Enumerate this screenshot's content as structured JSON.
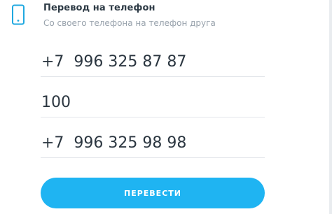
{
  "header": {
    "icon": "phone-icon",
    "title": "Перевод на телефон",
    "subtitle": "Со своего телефона на телефон друга"
  },
  "form": {
    "sender_phone": "+7  996 325 87 87",
    "amount": "100",
    "recipient_phone": "+7  996 325 98 98"
  },
  "actions": {
    "submit_label": "ПЕРЕВЕСТИ"
  },
  "colors": {
    "accent": "#1fb4f2",
    "icon": "#1fa8e0",
    "text": "#2b3640",
    "muted": "#98a2ac"
  }
}
